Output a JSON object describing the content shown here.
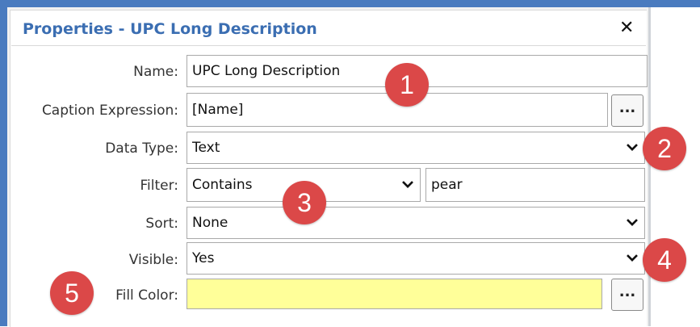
{
  "panel": {
    "title": "Properties - UPC Long Description"
  },
  "fields": {
    "name": {
      "label": "Name:",
      "value": "UPC Long Description"
    },
    "caption_expression": {
      "label": "Caption Expression:",
      "value": "[Name]",
      "button": "..."
    },
    "data_type": {
      "label": "Data Type:",
      "value": "Text"
    },
    "filter": {
      "label": "Filter:",
      "operator": "Contains",
      "value": "pear"
    },
    "sort": {
      "label": "Sort:",
      "value": "None"
    },
    "visible": {
      "label": "Visible:",
      "value": "Yes"
    },
    "fill_color": {
      "label": "Fill Color:",
      "swatch": "#ffff99",
      "button": "..."
    }
  },
  "badges": [
    "1",
    "2",
    "3",
    "4",
    "5"
  ],
  "icons": {
    "close": "×",
    "chevron": "❯"
  },
  "colors": {
    "accent": "#4a7bbf",
    "title": "#3b6eb2",
    "badge": "#db4848"
  }
}
